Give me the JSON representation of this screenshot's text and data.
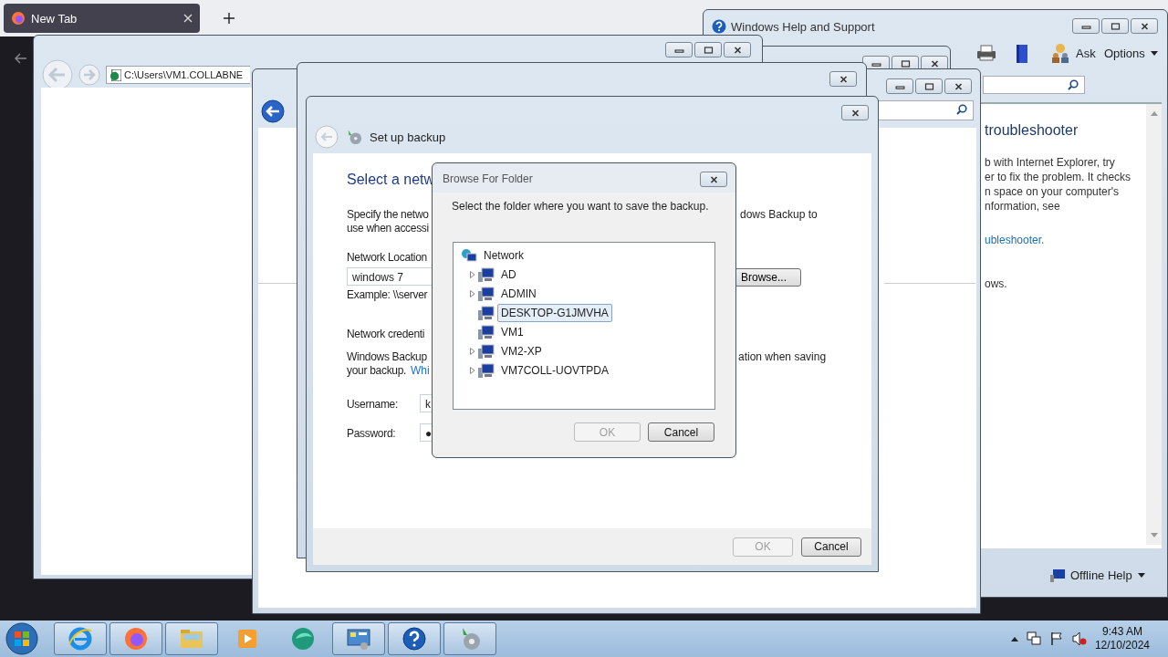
{
  "browser": {
    "tab": {
      "title": "New Tab",
      "selected": true
    }
  },
  "explorer_window": {
    "address": "C:\\Users\\VM1.COLLABNE"
  },
  "help_window": {
    "title": "Windows Help and Support",
    "toolbar": {
      "ask": "Ask",
      "options": "Options"
    },
    "content": {
      "heading": "troubleshooter",
      "lines": [
        "b with Internet Explorer, try",
        "er to fix the problem. It checks",
        "n space on your computer's",
        "nformation, see"
      ],
      "link": "ubleshooter.",
      "tail": "ows."
    },
    "footer": "Offline Help"
  },
  "backup_dialog": {
    "title": "Set up backup",
    "heading": "Select a netw",
    "desc_left": [
      "Specify the netwo",
      "use when accessi"
    ],
    "desc_right": "dows Backup to",
    "location_label": "Network Location",
    "location_value": "windows 7",
    "browse": "Browse...",
    "example": "Example: \\\\server",
    "credentials_heading": "Network credenti",
    "cred_left": [
      "Windows Backup",
      "your backup."
    ],
    "cred_link": "Whi",
    "cred_right": "ation when saving",
    "username_label": "Username:",
    "username_value": "k",
    "password_label": "Password:",
    "password_value": "●",
    "buttons": [
      {
        "label": "OK",
        "disabled": true
      },
      {
        "label": "Cancel",
        "disabled": false
      }
    ]
  },
  "browse_dialog": {
    "title": "Browse For Folder",
    "instruction": "Select the folder where you want to save the backup.",
    "tree": [
      {
        "label": "Network",
        "kind": "network",
        "expandable": false,
        "selected": false,
        "children": [
          {
            "label": "AD",
            "kind": "computer",
            "expandable": true,
            "selected": false
          },
          {
            "label": "ADMIN",
            "kind": "computer",
            "expandable": true,
            "selected": false
          },
          {
            "label": "DESKTOP-G1JMVHA",
            "kind": "computer",
            "expandable": false,
            "selected": true
          },
          {
            "label": "VM1",
            "kind": "computer",
            "expandable": false,
            "selected": false
          },
          {
            "label": "VM2-XP",
            "kind": "computer",
            "expandable": true,
            "selected": false
          },
          {
            "label": "VM7COLL-UOVTPDA",
            "kind": "computer",
            "expandable": true,
            "selected": false
          }
        ]
      }
    ],
    "buttons": [
      {
        "label": "OK",
        "disabled": true
      },
      {
        "label": "Cancel",
        "disabled": false
      }
    ]
  },
  "taskbar": {
    "apps": [
      {
        "kind": "ie",
        "running": true
      },
      {
        "kind": "firefox",
        "running": true
      },
      {
        "kind": "explorer",
        "running": true
      },
      {
        "kind": "media",
        "running": false
      },
      {
        "kind": "globe",
        "running": false
      },
      {
        "kind": "panel",
        "running": true
      },
      {
        "kind": "help",
        "running": true
      },
      {
        "kind": "backup",
        "running": true
      }
    ],
    "time": "9:43 AM",
    "date": "12/10/2024"
  }
}
